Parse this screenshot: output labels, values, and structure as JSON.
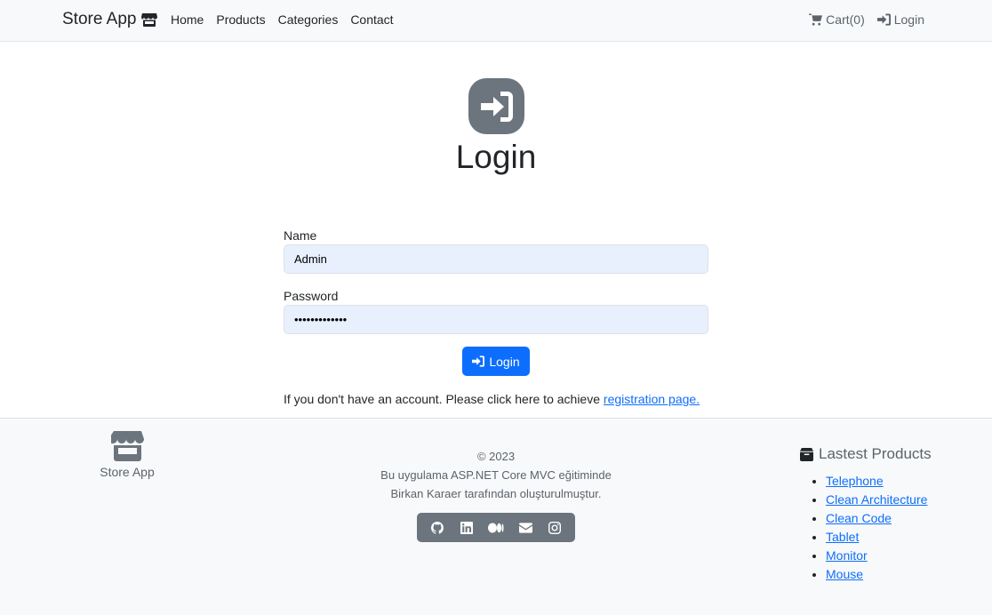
{
  "navbar": {
    "brand": "Store App",
    "links": [
      "Home",
      "Products",
      "Categories",
      "Contact"
    ],
    "cart": "Cart(0)",
    "login": "Login"
  },
  "hero": {
    "title": "Login"
  },
  "form": {
    "name_label": "Name",
    "name_value": "Admin",
    "password_label": "Password",
    "password_value": "•••••••••••••",
    "submit_label": "Login",
    "register_prefix": "If you don't have an account. Please click here to achieve ",
    "register_link": "registration page."
  },
  "footer": {
    "brand": "Store App",
    "copyright": "© 2023",
    "line1": "Bu uygulama ASP.NET Core MVC eğitiminde",
    "line2": "Birkan Karaer tarafından oluşturulmuştur.",
    "social_icons": [
      "github-icon",
      "linkedin-icon",
      "medium-icon",
      "envelope-icon",
      "instagram-icon"
    ],
    "latest_title": "Lastest Products",
    "latest_products": [
      "Telephone",
      "Clean Architecture",
      "Clean Code",
      "Tablet",
      "Monitor",
      "Mouse"
    ]
  },
  "colors": {
    "primary": "#0d6efd",
    "secondary": "#6c757d",
    "light": "#f8f9fa",
    "autofill": "#e8f0fe"
  }
}
